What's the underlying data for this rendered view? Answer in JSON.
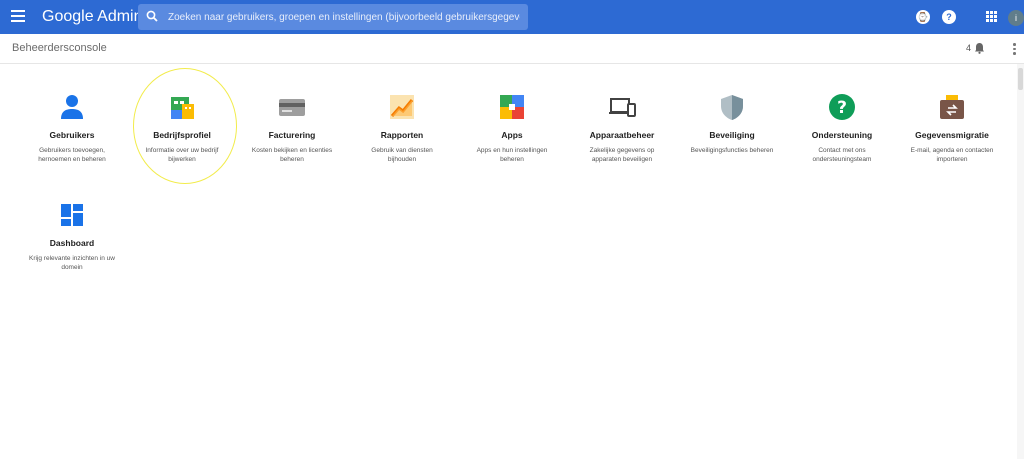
{
  "header": {
    "brand": "Google Admin",
    "search_placeholder": "Zoeken naar gebruikers, groepen en instellingen (bijvoorbeeld gebruikersgegevens beheren)",
    "icons": [
      "menu-icon",
      "search-icon",
      "timer-icon",
      "help-icon",
      "apps-grid-icon",
      "account-avatar"
    ]
  },
  "subheader": {
    "title": "Beheerdersconsole",
    "notification_count": "4"
  },
  "tiles": [
    {
      "title": "Gebruikers",
      "desc": "Gebruikers toevoegen, hernoemen en beheren",
      "icon": "user-icon"
    },
    {
      "title": "Bedrijfsprofiel",
      "desc": "Informatie over uw bedrijf bijwerken",
      "icon": "building-icon"
    },
    {
      "title": "Facturering",
      "desc": "Kosten bekijken en licenties beheren",
      "icon": "credit-card-icon"
    },
    {
      "title": "Rapporten",
      "desc": "Gebruik van diensten bijhouden",
      "icon": "reports-chart-icon"
    },
    {
      "title": "Apps",
      "desc": "Apps en hun instellingen beheren",
      "icon": "apps-icon"
    },
    {
      "title": "Apparaatbeheer",
      "desc": "Zakelijke gegevens op apparaten beveiligen",
      "icon": "devices-icon"
    },
    {
      "title": "Beveiliging",
      "desc": "Beveiligingsfuncties beheren",
      "icon": "shield-icon"
    },
    {
      "title": "Ondersteuning",
      "desc": "Contact met ons ondersteuningsteam",
      "icon": "help-circle-icon"
    },
    {
      "title": "Gegevensmigratie",
      "desc": "E-mail, agenda en contacten importeren",
      "icon": "data-migration-icon"
    },
    {
      "title": "Dashboard",
      "desc": "Krijg relevante inzichten in uw domein",
      "icon": "dashboard-icon"
    }
  ],
  "colors": {
    "topbar": "#2d6ad3",
    "highlight_circle": "#f2ec4c"
  }
}
